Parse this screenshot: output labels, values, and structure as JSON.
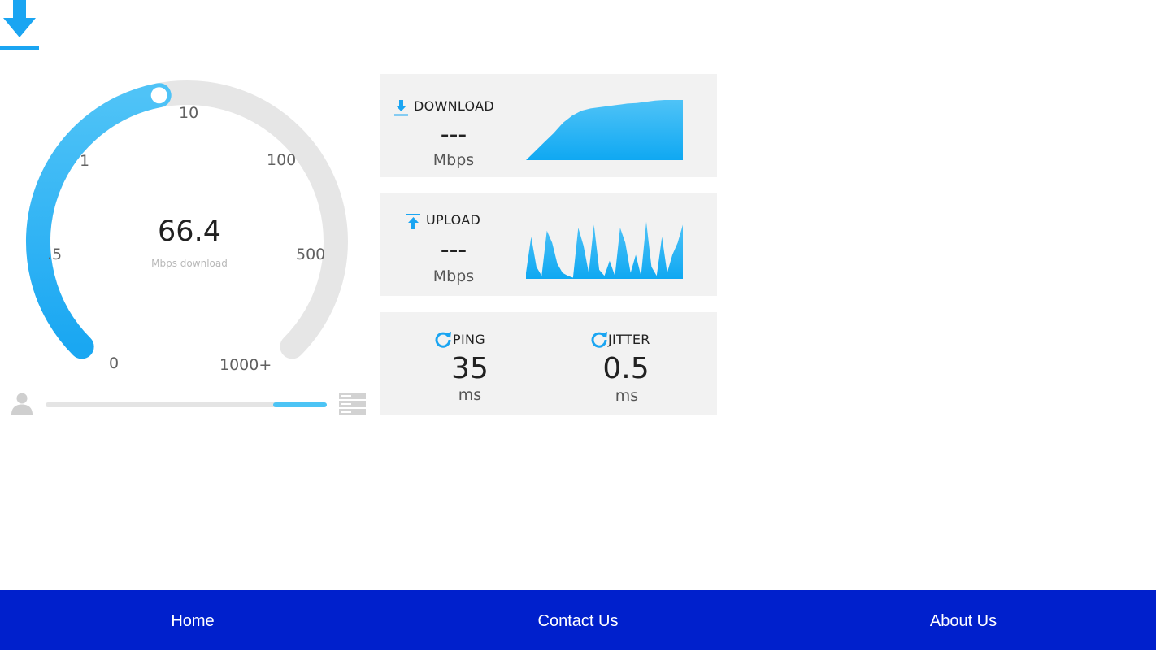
{
  "gauge": {
    "value": "66.4",
    "unit_label": "Mbps download",
    "needle_fraction": 0.46,
    "ticks": [
      "0",
      ".5",
      "1",
      "10",
      "100",
      "500",
      "1000+"
    ],
    "colors": {
      "active": "#29b6f6",
      "track": "#e6e6e6",
      "knob": "#ffffff"
    }
  },
  "progress": {
    "start_fraction": 0.81,
    "end_fraction": 1.0
  },
  "metrics": {
    "download": {
      "title": "DOWNLOAD",
      "value": "---",
      "unit": "Mbps",
      "sparkline": [
        0,
        15,
        30,
        45,
        62,
        74,
        82,
        86,
        88,
        90,
        92,
        94,
        95,
        97,
        99,
        100,
        100,
        100
      ]
    },
    "upload": {
      "title": "UPLOAD",
      "value": "---",
      "unit": "Mbps",
      "sparkline": [
        10,
        70,
        20,
        5,
        80,
        60,
        25,
        10,
        5,
        2,
        85,
        55,
        10,
        90,
        15,
        5,
        30,
        5,
        85,
        60,
        10,
        40,
        5,
        95,
        20,
        5,
        70,
        10,
        40,
        60,
        90
      ]
    },
    "ping": {
      "title": "PING",
      "value": "35",
      "unit": "ms"
    },
    "jitter": {
      "title": "JITTER",
      "value": "0.5",
      "unit": "ms"
    }
  },
  "accent_color": "#1aa5f2",
  "nav": {
    "home": "Home",
    "contact": "Contact Us",
    "about": "About Us",
    "background": "#0020cc"
  }
}
